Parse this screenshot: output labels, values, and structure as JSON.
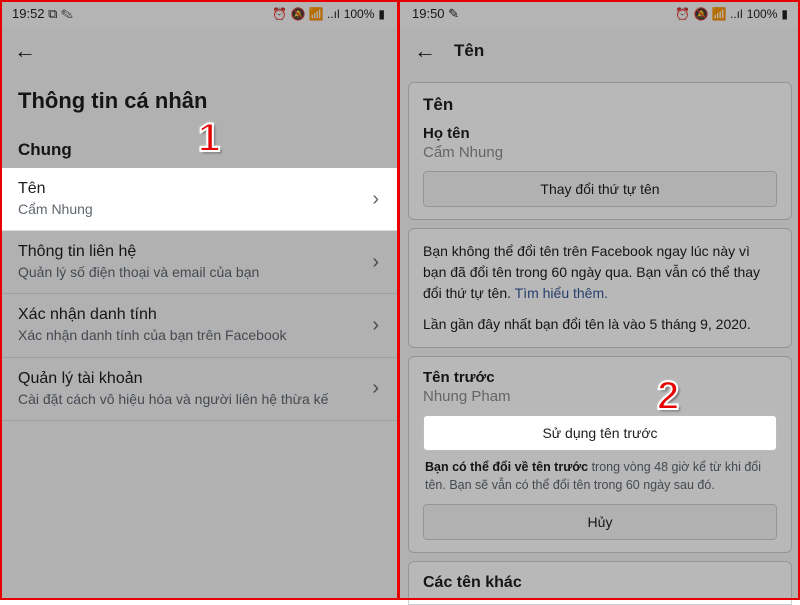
{
  "left": {
    "status": {
      "time": "19:52",
      "battery": "100%"
    },
    "page_title": "Thông tin cá nhân",
    "section": "Chung",
    "rows": [
      {
        "title": "Tên",
        "sub": "Cẩm Nhung"
      },
      {
        "title": "Thông tin liên hệ",
        "sub": "Quản lý số điện thoại và email của bạn"
      },
      {
        "title": "Xác nhận danh tính",
        "sub": "Xác nhận danh tính của bạn trên Facebook"
      },
      {
        "title": "Quản lý tài khoản",
        "sub": "Cài đặt cách vô hiệu hóa và người liên hệ thừa kế"
      }
    ],
    "annotation": "1"
  },
  "right": {
    "status": {
      "time": "19:50",
      "battery": "100%"
    },
    "header": "Tên",
    "card_title": "Tên",
    "fullname_label": "Họ tên",
    "fullname_value": "Cẩm Nhung",
    "reorder_btn": "Thay đổi thứ tự tên",
    "info_p1a": "Bạn không thể đổi tên trên Facebook ngay lúc này vì bạn đã đổi tên trong 60 ngày qua. Bạn vẫn có thể thay đổi thứ tự tên. ",
    "info_link": "Tìm hiểu thêm.",
    "info_p2": "Lần gần đây nhất bạn đổi tên là vào 5 tháng 9, 2020.",
    "prev_label": "Tên trước",
    "prev_value": "Nhung Pham",
    "use_prev_btn": "Sử dụng tên trước",
    "foot_bold": "Bạn có thể đổi về tên trước",
    "foot_rest": " trong vòng 48 giờ kể từ khi đổi tên. Bạn sẽ vẫn có thể đổi tên trong 60 ngày sau đó.",
    "cancel_btn": "Hủy",
    "other_names": "Các tên khác",
    "annotation": "2"
  }
}
